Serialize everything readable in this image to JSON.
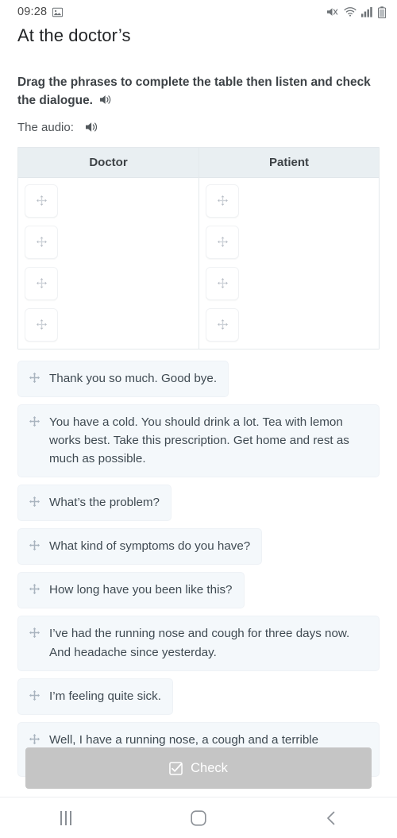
{
  "statusbar": {
    "time": "09:28",
    "icons": [
      "image-icon",
      "mute-icon",
      "wifi-icon",
      "signal-icon",
      "battery-icon"
    ]
  },
  "header": {
    "title": "At the doctor’s"
  },
  "instructions": {
    "text": "Drag the phrases to complete the table then listen and check the dialogue.",
    "audio_label": "The audio:",
    "speaker_icon": "speaker-icon"
  },
  "table": {
    "columns": [
      {
        "header": "Doctor",
        "slots": 4
      },
      {
        "header": "Patient",
        "slots": 4
      }
    ],
    "slot_icon": "move-icon"
  },
  "phrases": [
    {
      "text": "Thank you so much. Good bye.",
      "wide": false
    },
    {
      "text": "You have a cold. You should drink a lot. Tea with lemon works best. Take this prescription. Get home and rest as much as possible.",
      "wide": true
    },
    {
      "text": "What’s the problem?",
      "wide": false
    },
    {
      "text": "What kind of symptoms do you have?",
      "wide": false
    },
    {
      "text": "How long have you been like this?",
      "wide": false
    },
    {
      "text": "I’ve had the running nose and cough for three days now. And headache since yesterday.",
      "wide": true
    },
    {
      "text": "I’m feeling quite sick.",
      "wide": false
    },
    {
      "text": "Well, I have a running nose, a cough and a terrible headache, which is making me feel bad.",
      "wide": true
    }
  ],
  "actions": {
    "check_label": "Check",
    "check_icon": "checkbox-checked-icon",
    "check_color": "#c5c5c5"
  },
  "navbar": {
    "recents": "recents-icon",
    "home": "home-icon",
    "back": "back-icon"
  }
}
